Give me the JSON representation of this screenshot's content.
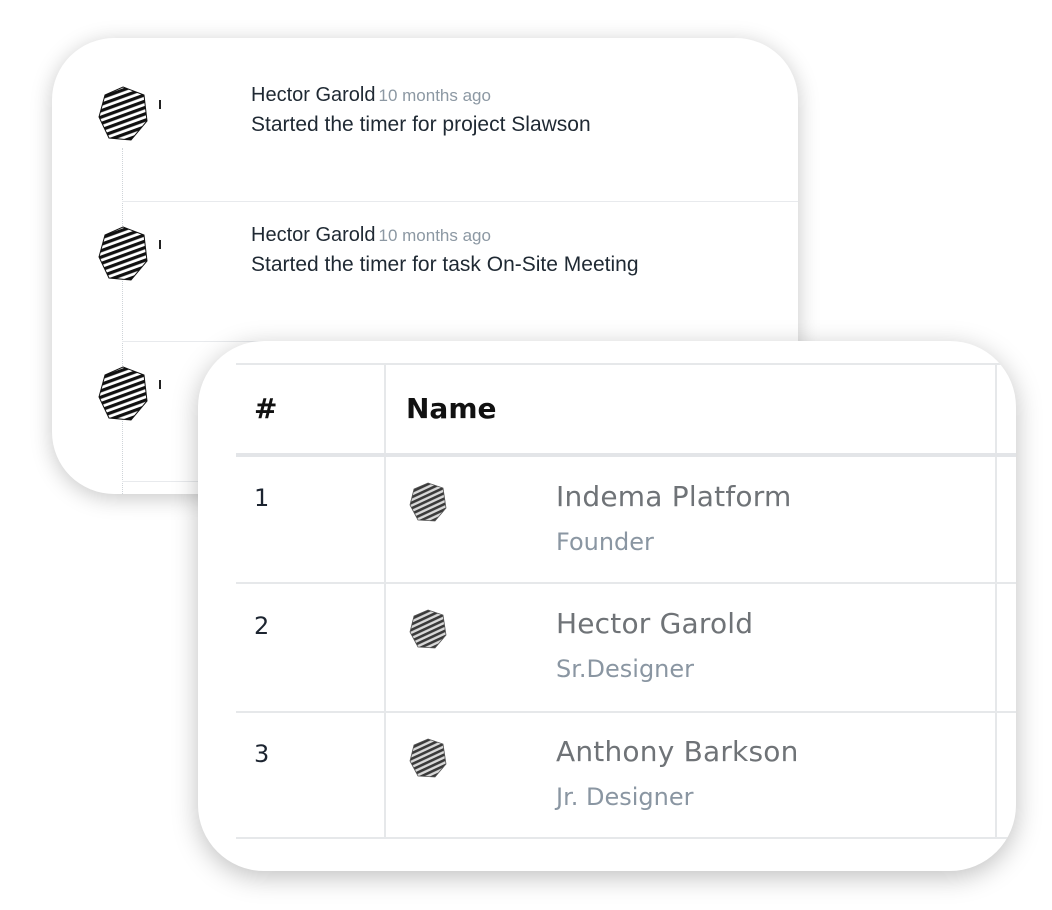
{
  "activity": {
    "items": [
      {
        "author": "Hector Garold",
        "time": "10 months ago",
        "message": "Started the timer for project Slawson",
        "avatar_icon": "avatar-pattern-icon"
      },
      {
        "author": "Hector Garold",
        "time": "10 months ago",
        "message": "Started the timer for task On-Site Meeting",
        "avatar_icon": "avatar-pattern-icon"
      },
      {
        "author": "",
        "time": "",
        "message": "",
        "avatar_icon": "avatar-pattern-icon"
      }
    ]
  },
  "table": {
    "headers": {
      "number": "#",
      "name": "Name"
    },
    "rows": [
      {
        "number": "1",
        "name": "Indema Platform",
        "role": "Founder",
        "avatar_icon": "avatar-pattern-icon"
      },
      {
        "number": "2",
        "name": "Hector Garold",
        "role": "Sr.Designer",
        "avatar_icon": "avatar-pattern-icon"
      },
      {
        "number": "3",
        "name": "Anthony Barkson",
        "role": "Jr. Designer",
        "avatar_icon": "avatar-pattern-icon"
      }
    ]
  }
}
